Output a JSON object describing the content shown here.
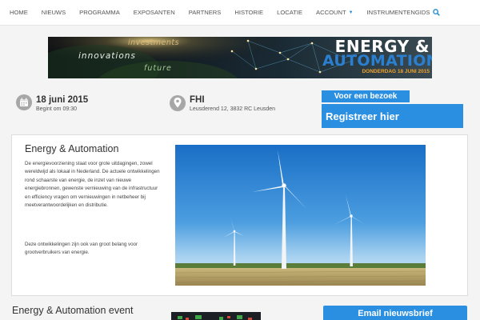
{
  "nav": {
    "items": [
      "HOME",
      "NIEUWS",
      "PROGRAMMA",
      "EXPOSANTEN",
      "PARTNERS",
      "HISTORIE",
      "LOCATIE",
      "ACCOUNT",
      "INSTRUMENTENGIDS"
    ],
    "account_icon": "chevron-down-icon",
    "search_icon": "search-icon"
  },
  "banner": {
    "word_investments": "investments",
    "word_innovations": "innovations",
    "word_future": "future",
    "title_line1": "ENERGY &",
    "title_line2": "AUTOMATION",
    "date_line": "DONDERDAG 18 JUNI 2015"
  },
  "event": {
    "date": "18 juni 2015",
    "start": "Begint om 09:30",
    "location_name": "FHI",
    "address": "Leusderend 12, 3832 RC Leusden"
  },
  "cta": {
    "visit_label": "Voor een bezoek",
    "register_label": "Registreer hier"
  },
  "intro": {
    "title": "Energy & Automation",
    "paragraph1": "De energievoorziening staat voor grote uitdagingen, zowel wereldwijd als lokaal in Nederland. De actuele ontwikkelingen rond schaarste van energie, de inzet van nieuwe energiebronnen, gewenste vernieuwing van de infrastructuur en efficiency vragen om vernieuwingen in netbeheer bij meetverantwoordelijken en distributie.",
    "paragraph2": "Deze ontwikkelingen zijn ook van groot belang voor grootverbruikers van energie.",
    "photo": "wind-turbines-photo"
  },
  "section2": {
    "title": "Energy & Automation event",
    "newsletter_label": "Email nieuwsbrief"
  },
  "colors": {
    "accent": "#2a8fe0",
    "page_bg": "#f4f4f4",
    "sky_top": "#1a72c8",
    "field": "#b4a268"
  }
}
